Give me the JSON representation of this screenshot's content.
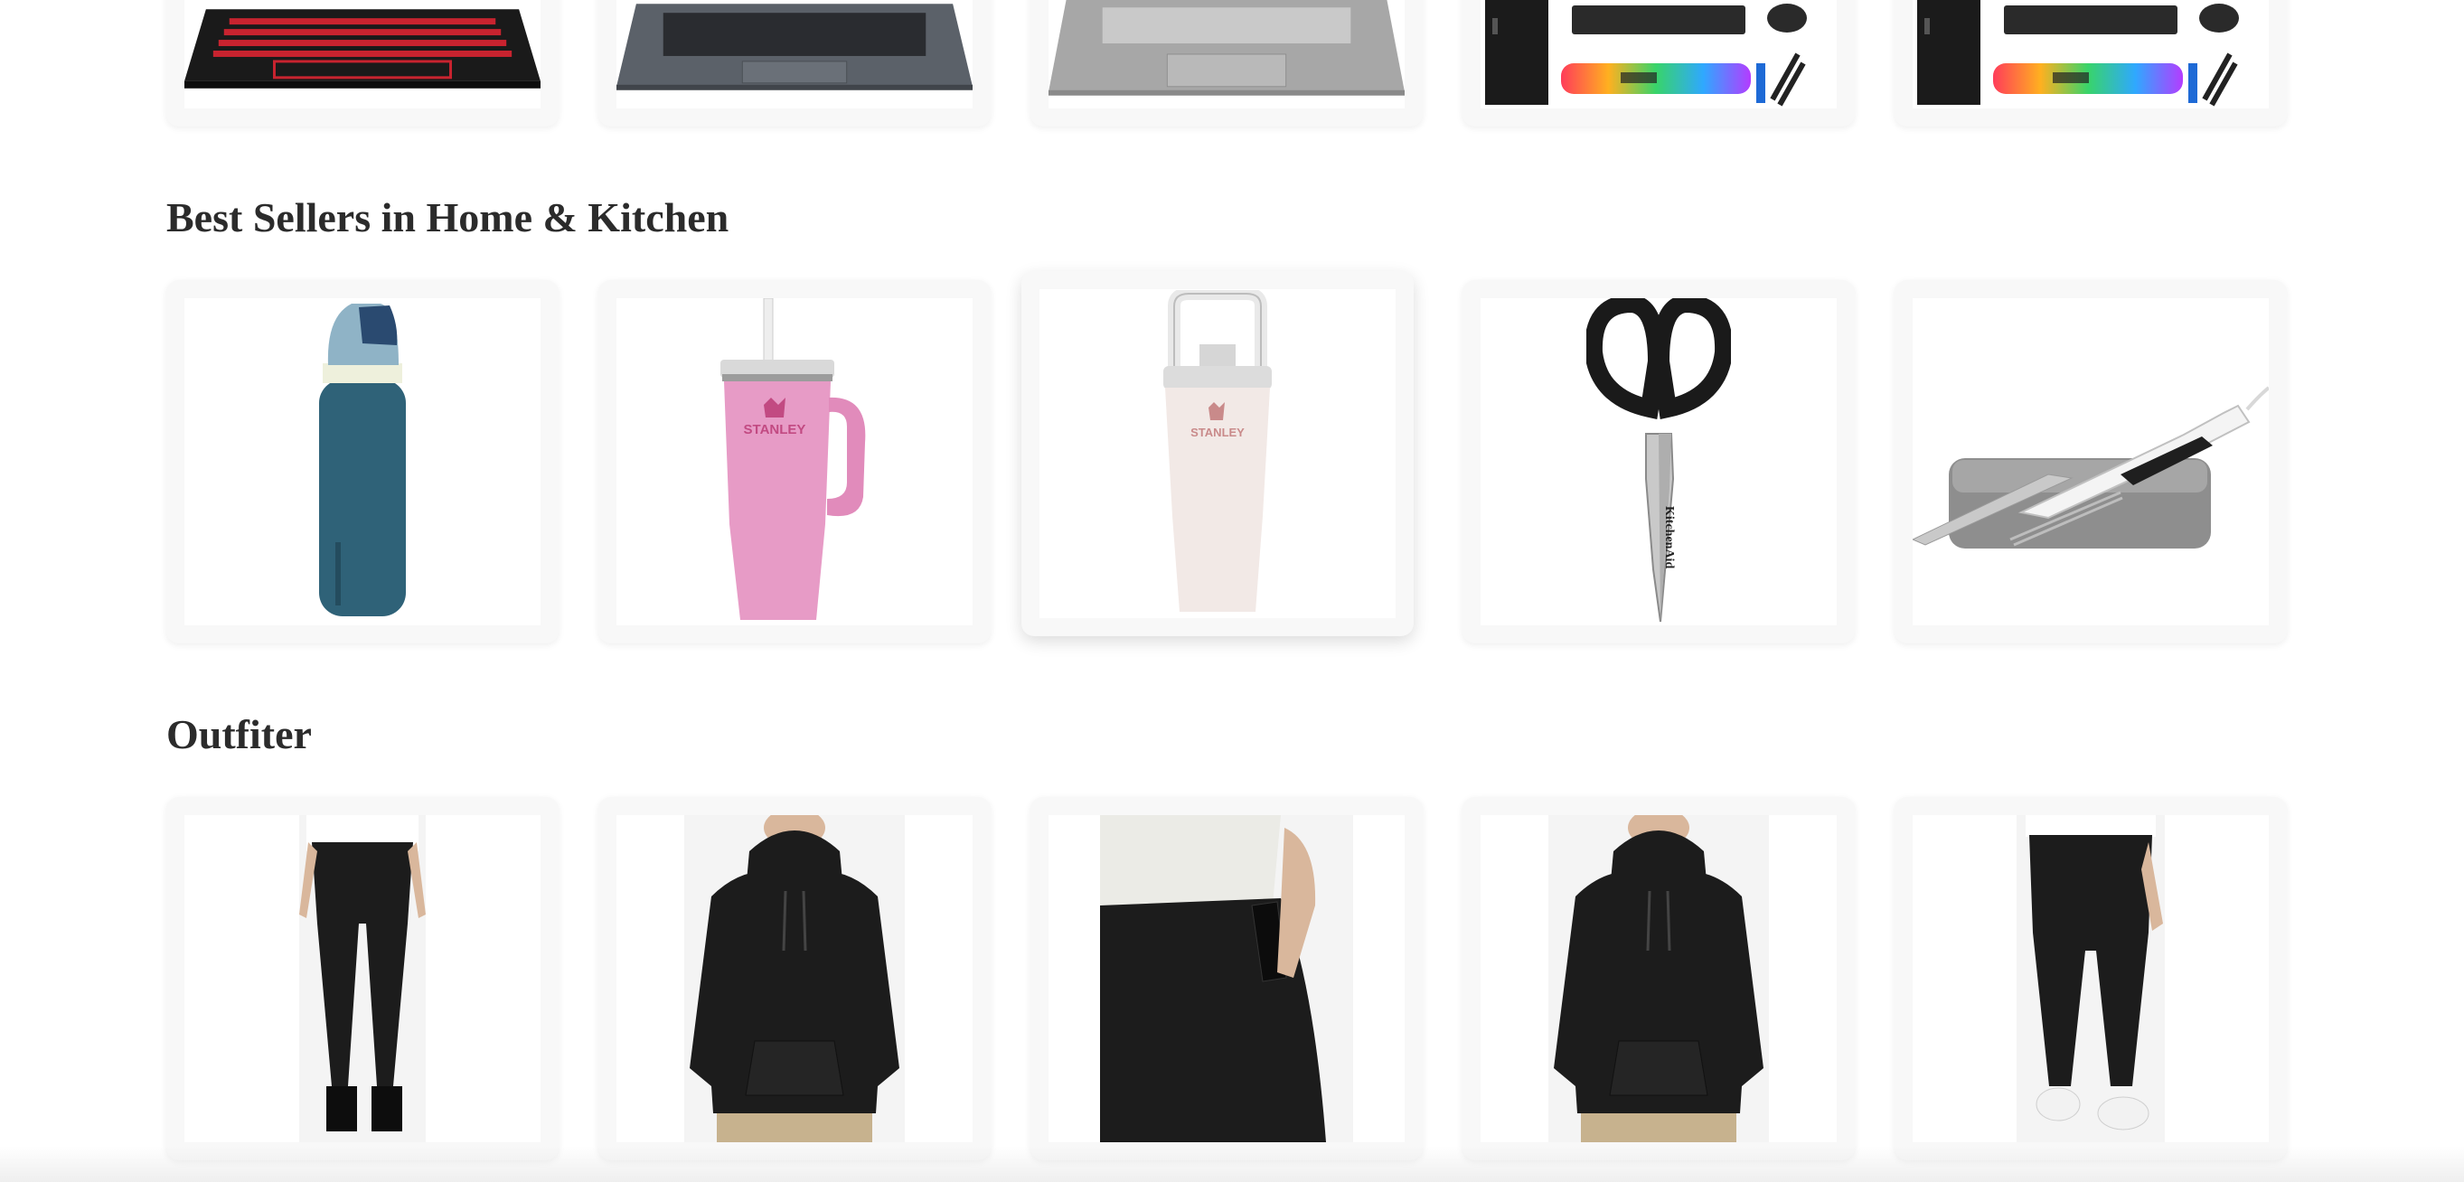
{
  "sections": [
    {
      "id": "electronics",
      "title": "",
      "products": [
        {
          "name": "Gaming laptop red backlit keyboard",
          "image": "laptop-image"
        },
        {
          "name": "Slim dark gray laptop",
          "image": "laptop-image"
        },
        {
          "name": "Silver laptop",
          "image": "laptop-image"
        },
        {
          "name": "Desktop PC bundle with RGB speaker",
          "image": "desktop-bundle-image"
        },
        {
          "name": "Desktop PC bundle with RGB speaker",
          "image": "desktop-bundle-image"
        }
      ]
    },
    {
      "id": "home-kitchen",
      "title": "Best Sellers in Home & Kitchen",
      "products": [
        {
          "name": "Blue insulated water bottle",
          "image": "water-bottle-image"
        },
        {
          "name": "Pink Stanley tumbler with straw",
          "image": "tumbler-image"
        },
        {
          "name": "Cream Stanley flip straw tumbler",
          "image": "flip-tumbler-image"
        },
        {
          "name": "KitchenAid kitchen shears",
          "image": "scissors-image"
        },
        {
          "name": "Electric knife set with case",
          "image": "electric-knife-image"
        }
      ]
    },
    {
      "id": "outfitter",
      "title": "Outfiter",
      "products": [
        {
          "name": "Black maternity leggings",
          "image": "leggings-image"
        },
        {
          "name": "Black pullover hoodie",
          "image": "hoodie-image"
        },
        {
          "name": "Maternity pants pocket detail",
          "image": "pants-detail-image"
        },
        {
          "name": "Black pullover hoodie",
          "image": "hoodie-image"
        },
        {
          "name": "Black leggings back view",
          "image": "leggings-back-image"
        }
      ]
    }
  ],
  "colors": {
    "title": "#2b2b2b",
    "card_bg": "#f8f8f8",
    "bottle_blue": "#2f6278",
    "tumbler_pink": "#e79bc6",
    "tumbler_cream": "#f2e9e6",
    "stanley_logo": "#c24a82",
    "apparel_black": "#1c1c1c"
  }
}
